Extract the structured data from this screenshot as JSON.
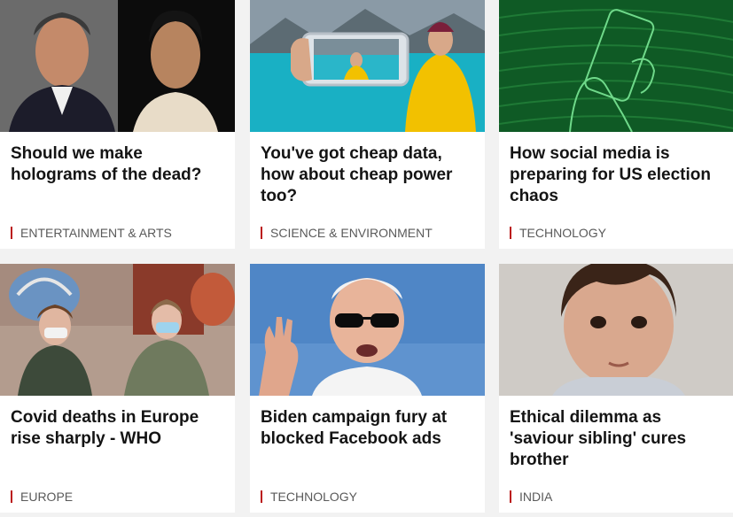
{
  "cards": [
    {
      "headline": "Should we make holograms of the dead?",
      "section": "ENTERTAINMENT & ARTS",
      "image": "two-men-portraits"
    },
    {
      "headline": "You've got cheap data, how about cheap power too?",
      "section": "SCIENCE & ENVIRONMENT",
      "image": "phone-selfie-lake"
    },
    {
      "headline": "How social media is preparing for US election chaos",
      "section": "TECHNOLOGY",
      "image": "green-hand-phone"
    },
    {
      "headline": "Covid deaths in Europe rise sharply - WHO",
      "section": "EUROPE",
      "image": "masked-women-moscow"
    },
    {
      "headline": "Biden campaign fury at blocked Facebook ads",
      "section": "TECHNOLOGY",
      "image": "man-sunglasses-waving"
    },
    {
      "headline": "Ethical dilemma as 'saviour sibling' cures brother",
      "section": "INDIA",
      "image": "young-child-portrait"
    }
  ],
  "colors": {
    "section_bar": "#bb1919",
    "headline": "#141414",
    "section_text": "#5a5a5a",
    "page_bg": "#f2f2f2"
  }
}
